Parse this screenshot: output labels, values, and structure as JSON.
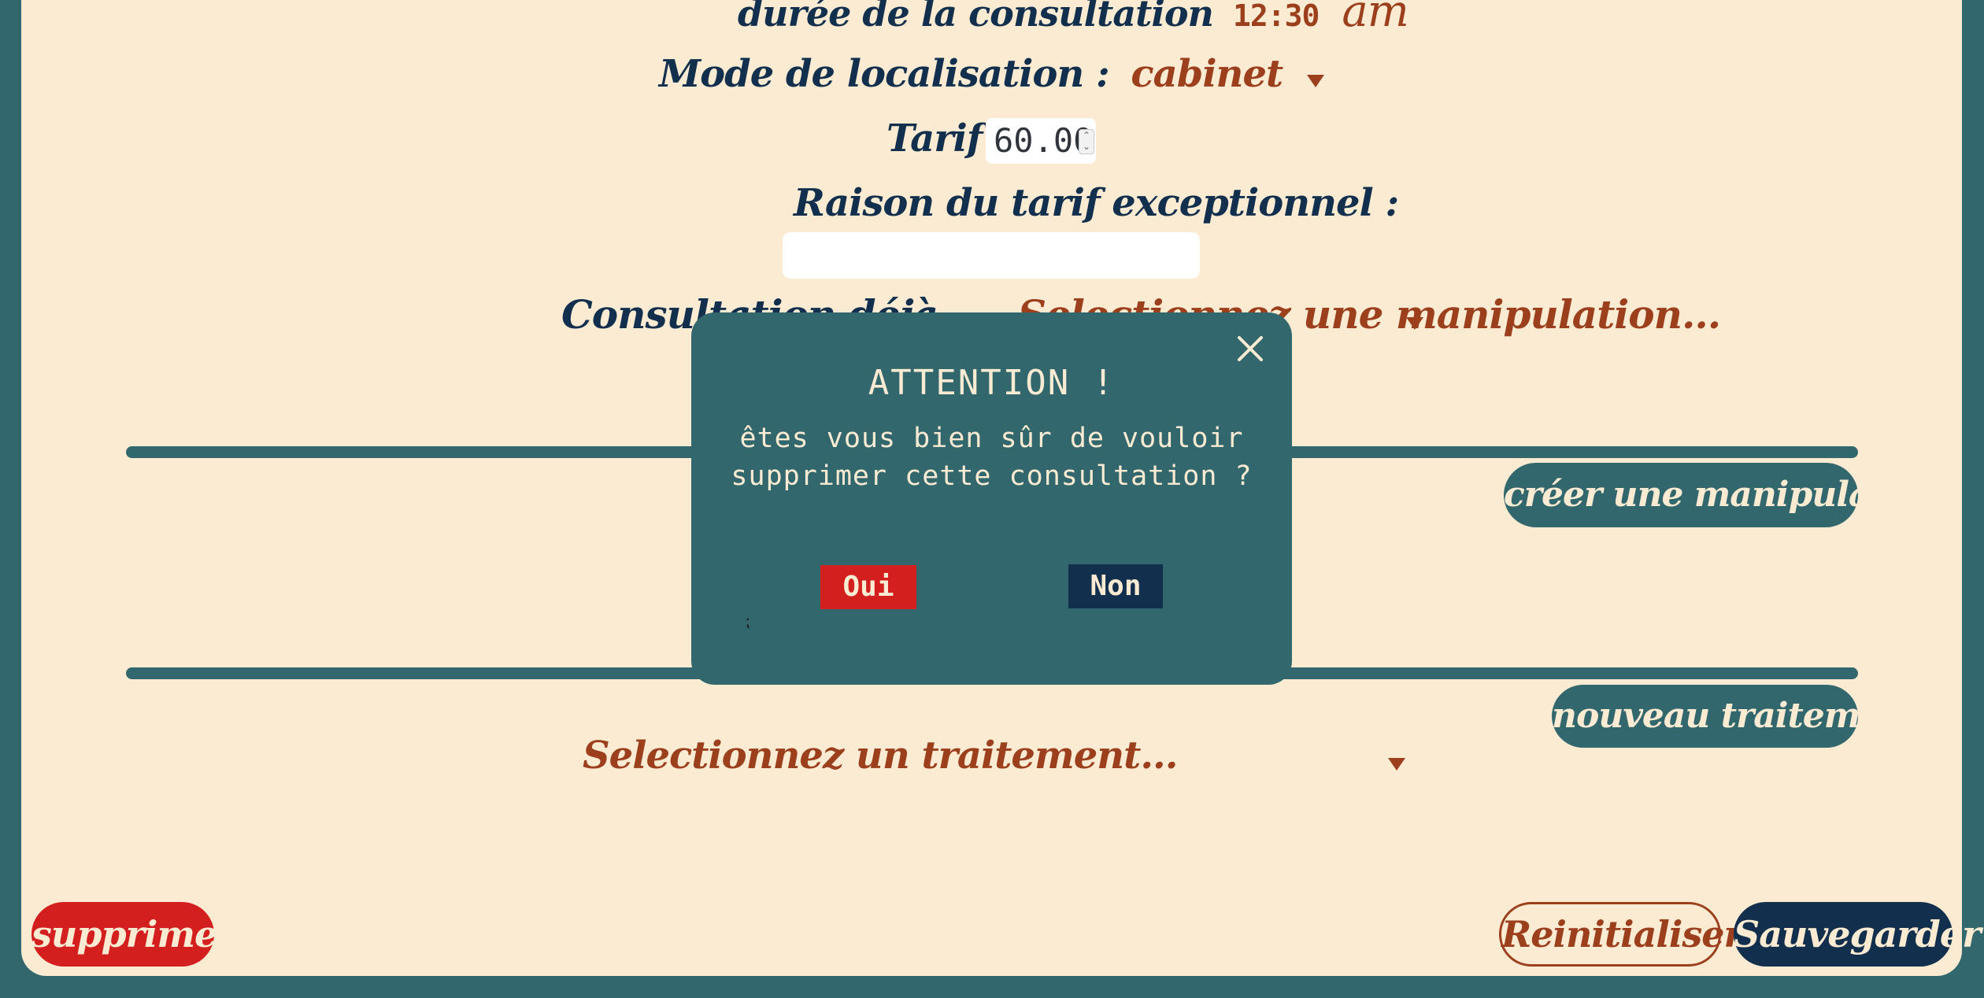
{
  "form": {
    "duree_label": "durée de la consultation",
    "duree_value": "12:30",
    "duree_ampm": "am",
    "mode_label": "Mode de localisation :",
    "mode_value": "cabinet",
    "tarif_label": "Tarif :",
    "tarif_value": "60.00",
    "raison_label": "Raison du tarif exceptionnel :",
    "raison_value": "",
    "consultation_label": "Consultation déjà ...",
    "consultation_value": "Selectionnez une manipulation..."
  },
  "manipulations": {
    "create_button": "créer une manipulation"
  },
  "traitements": {
    "new_button": "nouveau traitement",
    "select_placeholder": "Selectionnez un traitement..."
  },
  "footer": {
    "delete_button": "supprimer",
    "reset_button": "Reinitialiser",
    "save_button": "Sauvegarder"
  },
  "modal": {
    "title": "ATTENTION !",
    "message": "êtes vous bien sûr de vouloir supprimer cette consultation ?",
    "yes_button": "Oui",
    "no_button": "Non",
    "close_icon": "close-icon"
  },
  "colors": {
    "background_teal": "#31676d",
    "panel_cream": "#fcebd3",
    "navy": "#12304d",
    "rust": "#9c3f1d",
    "danger_red": "#d41f1f"
  }
}
